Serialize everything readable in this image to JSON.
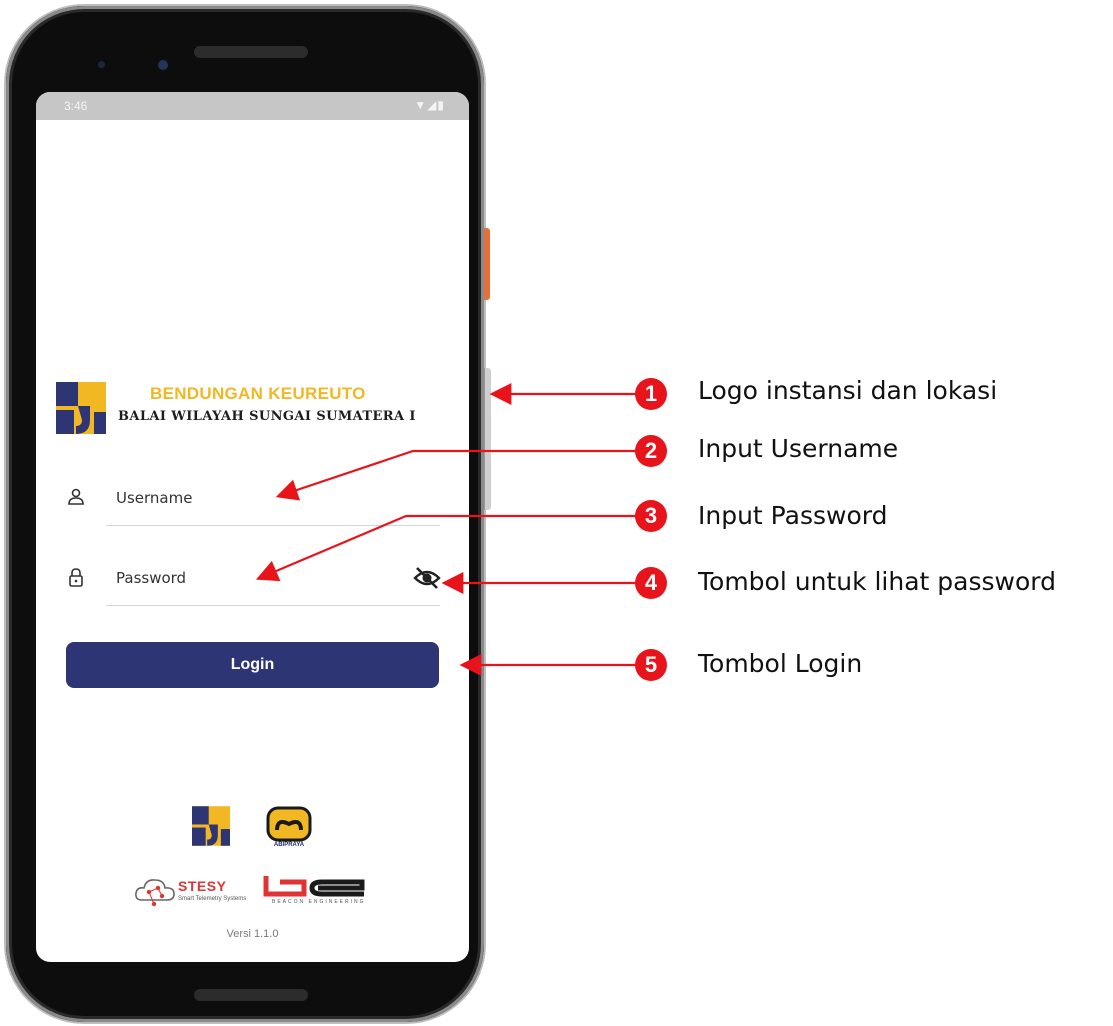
{
  "status_bar": {
    "time": "3:46",
    "icons": "▼◢▮"
  },
  "brand": {
    "title": "BENDUNGAN KEUREUTO",
    "subtitle": "BALAI WILAYAH SUNGAI SUMATERA I",
    "title_color": "#f2b824"
  },
  "form": {
    "username_placeholder": "Username",
    "password_placeholder": "Password",
    "login_label": "Login",
    "button_color": "#2e3575"
  },
  "footer": {
    "abipraya_label": "ABIPRAYA",
    "stesy_name": "STESY",
    "stesy_tagline": "Smart Telemetry Systems",
    "beacon_tagline": "BEACON ENGINEERING",
    "version": "Versi 1.1.0"
  },
  "annotations": [
    {
      "number": "1",
      "label": "Logo instansi dan lokasi"
    },
    {
      "number": "2",
      "label": "Input Username"
    },
    {
      "number": "3",
      "label": "Input Password"
    },
    {
      "number": "4",
      "label": "Tombol untuk lihat password"
    },
    {
      "number": "5",
      "label": "Tombol Login"
    }
  ],
  "annotation_color": "#e8141c"
}
